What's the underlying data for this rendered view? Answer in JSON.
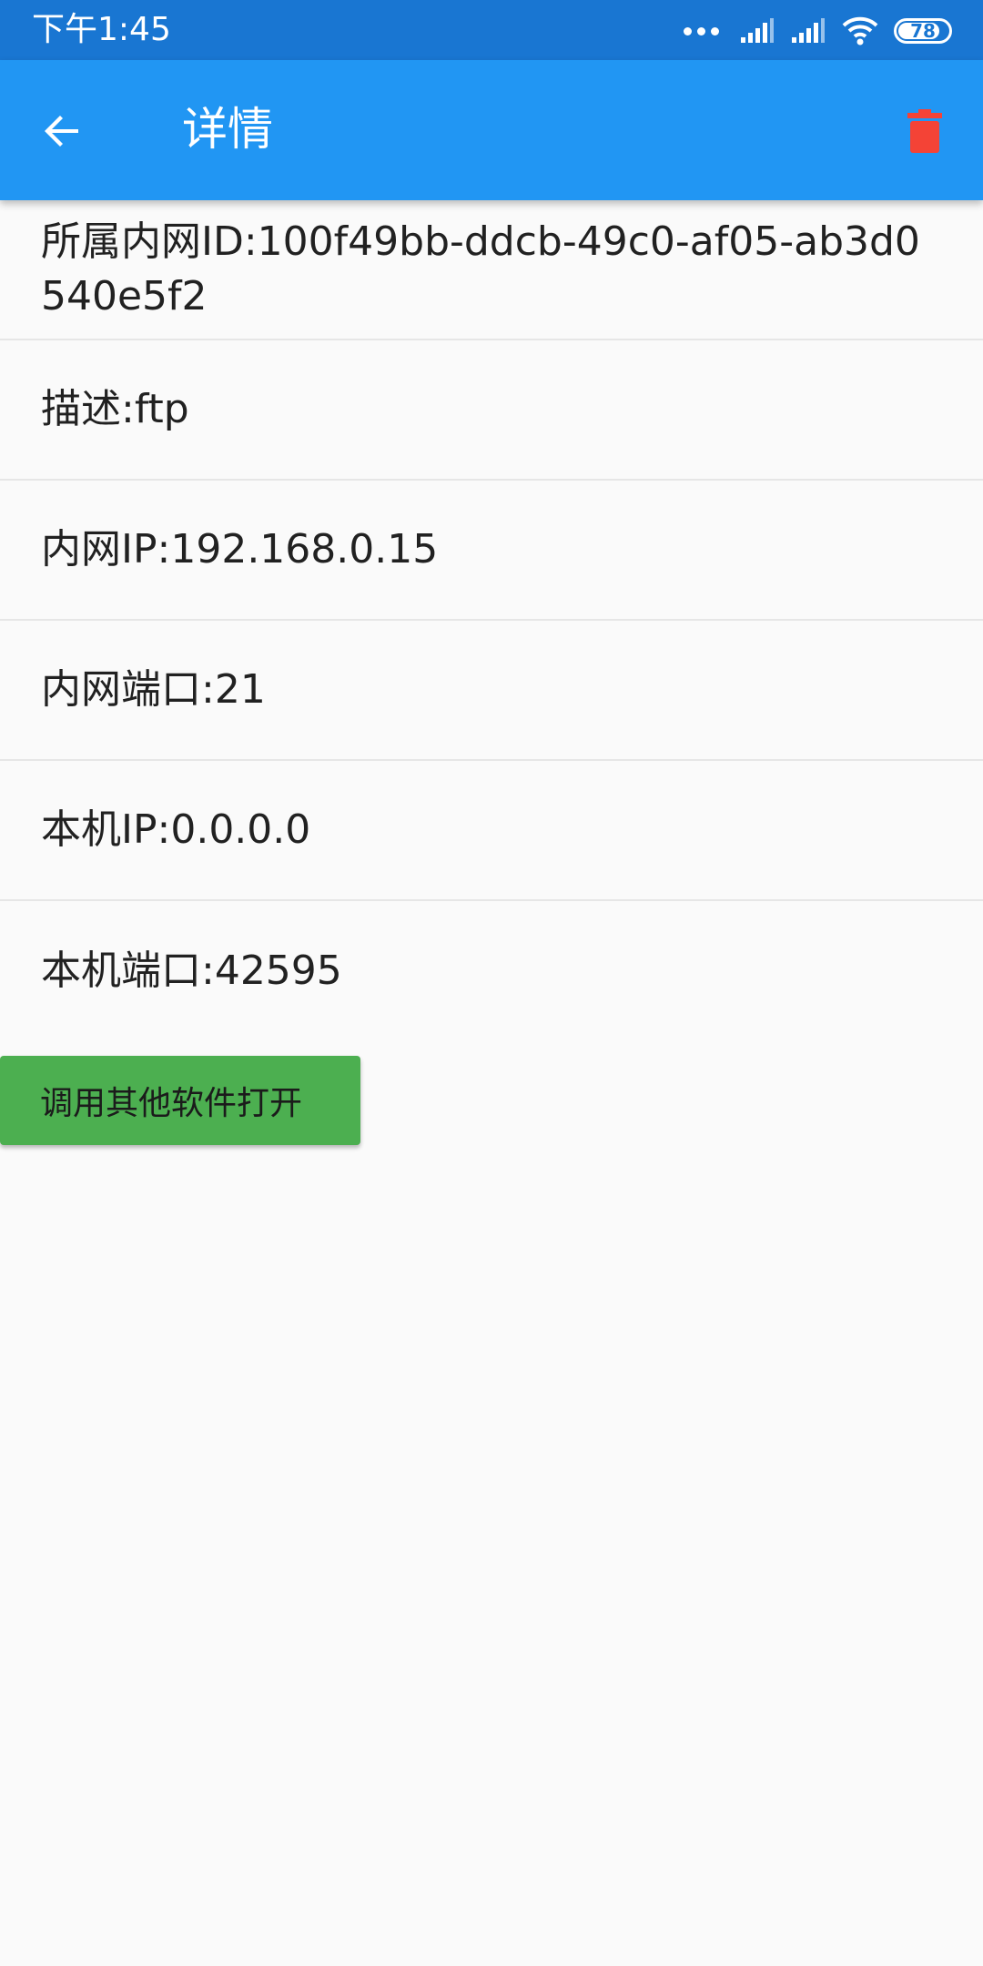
{
  "status_bar": {
    "time": "下午1:45",
    "battery_level": "78",
    "icons": [
      "dots-icon",
      "signal-icon",
      "signal-icon",
      "wifi-icon",
      "battery-icon"
    ]
  },
  "app_bar": {
    "title": "详情",
    "back_icon": "arrow-left-icon",
    "delete_icon": "trash-icon",
    "delete_color": "#f44336",
    "background_color": "#2196f3"
  },
  "details": {
    "intranet_id": "所属内网ID:100f49bb-ddcb-49c0-af05-ab3d0540e5f2",
    "description": "描述:ftp",
    "intranet_ip": "内网IP:192.168.0.15",
    "intranet_port": "内网端口:21",
    "local_ip": "本机IP:0.0.0.0",
    "local_port": "本机端口:42595"
  },
  "actions": {
    "open_with_other_app": "调用其他软件打开",
    "button_color": "#4caf50"
  }
}
